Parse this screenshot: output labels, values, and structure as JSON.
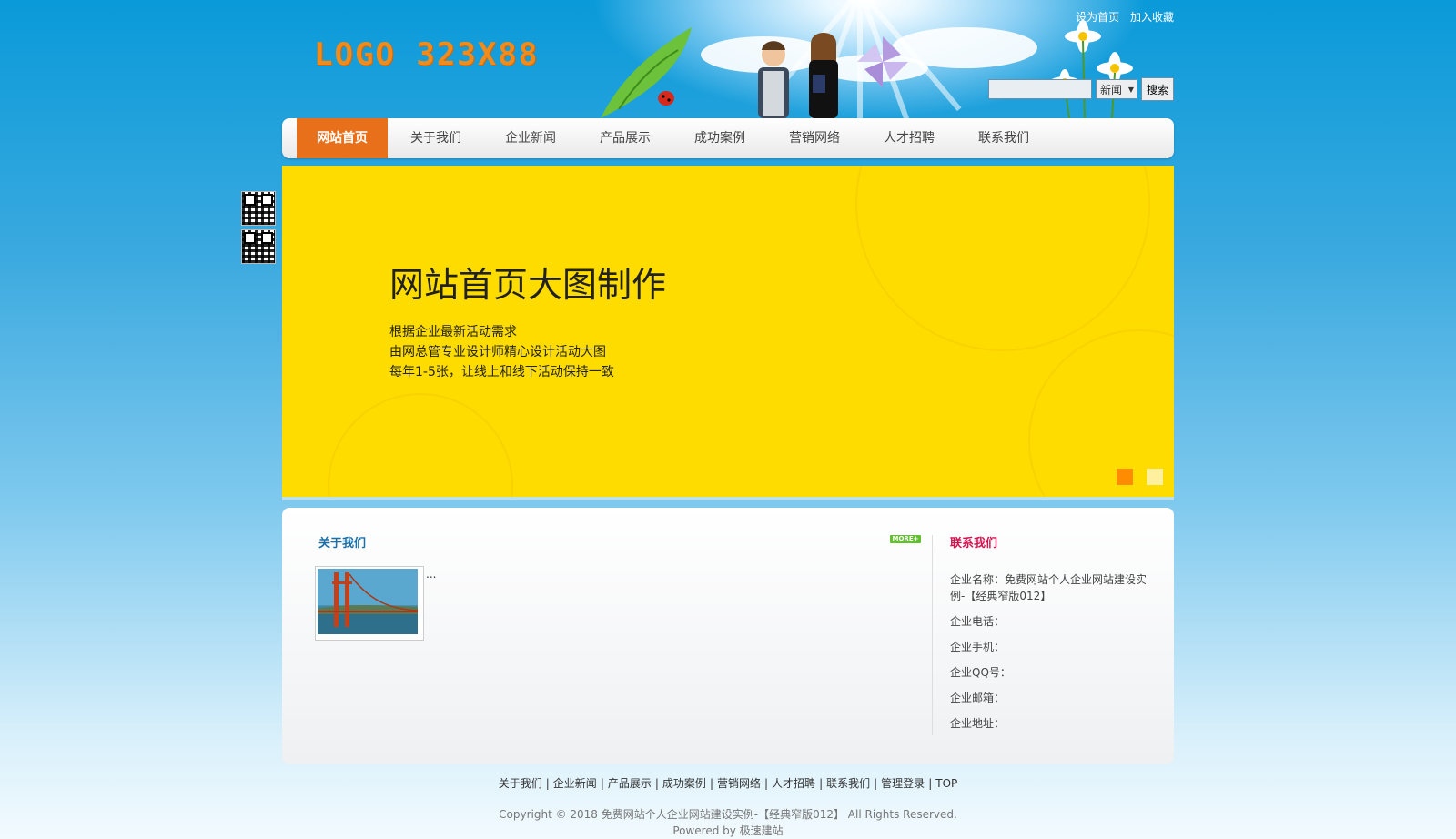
{
  "header": {
    "logo_text": "LOGO 323X88",
    "top_links": [
      "设为首页",
      "加入收藏"
    ],
    "search": {
      "input_value": "",
      "category_selected": "新闻",
      "button_label": "搜索"
    }
  },
  "nav": {
    "items": [
      "网站首页",
      "关于我们",
      "企业新闻",
      "产品展示",
      "成功案例",
      "营销网络",
      "人才招聘",
      "联系我们"
    ],
    "active_index": 0
  },
  "banner": {
    "title": "网站首页大图制作",
    "lines": [
      "根据企业最新活动需求",
      "由网总管专业设计师精心设计活动大图",
      "每年1-5张，让线上和线下活动保持一致"
    ],
    "background_color": "#ffdc00",
    "dot_active_color": "#ff8c00",
    "dot_inactive_color": "#fff0a0",
    "active_slide": 1,
    "slide_count": 2
  },
  "about": {
    "title": "关于我们",
    "more_label": "MORE+",
    "text": "..."
  },
  "contact": {
    "title": "联系我们",
    "lines": [
      "企业名称：免费网站个人企业网站建设实例-【经典窄版012】",
      "企业电话：",
      "企业手机：",
      "企业QQ号：",
      "企业邮箱：",
      "企业地址："
    ]
  },
  "footer": {
    "links": [
      "关于我们",
      "企业新闻",
      "产品展示",
      "成功案例",
      "营销网络",
      "人才招聘",
      "联系我们",
      "管理登录",
      "TOP"
    ],
    "copyright": "Copyright © 2018 免费网站个人企业网站建设实例-【经典窄版012】 All Rights Reserved.",
    "powered": "Powered by 极速建站"
  },
  "colors": {
    "accent_orange": "#e8701a",
    "about_title": "#1a6fa8",
    "contact_title": "#d0144f"
  }
}
